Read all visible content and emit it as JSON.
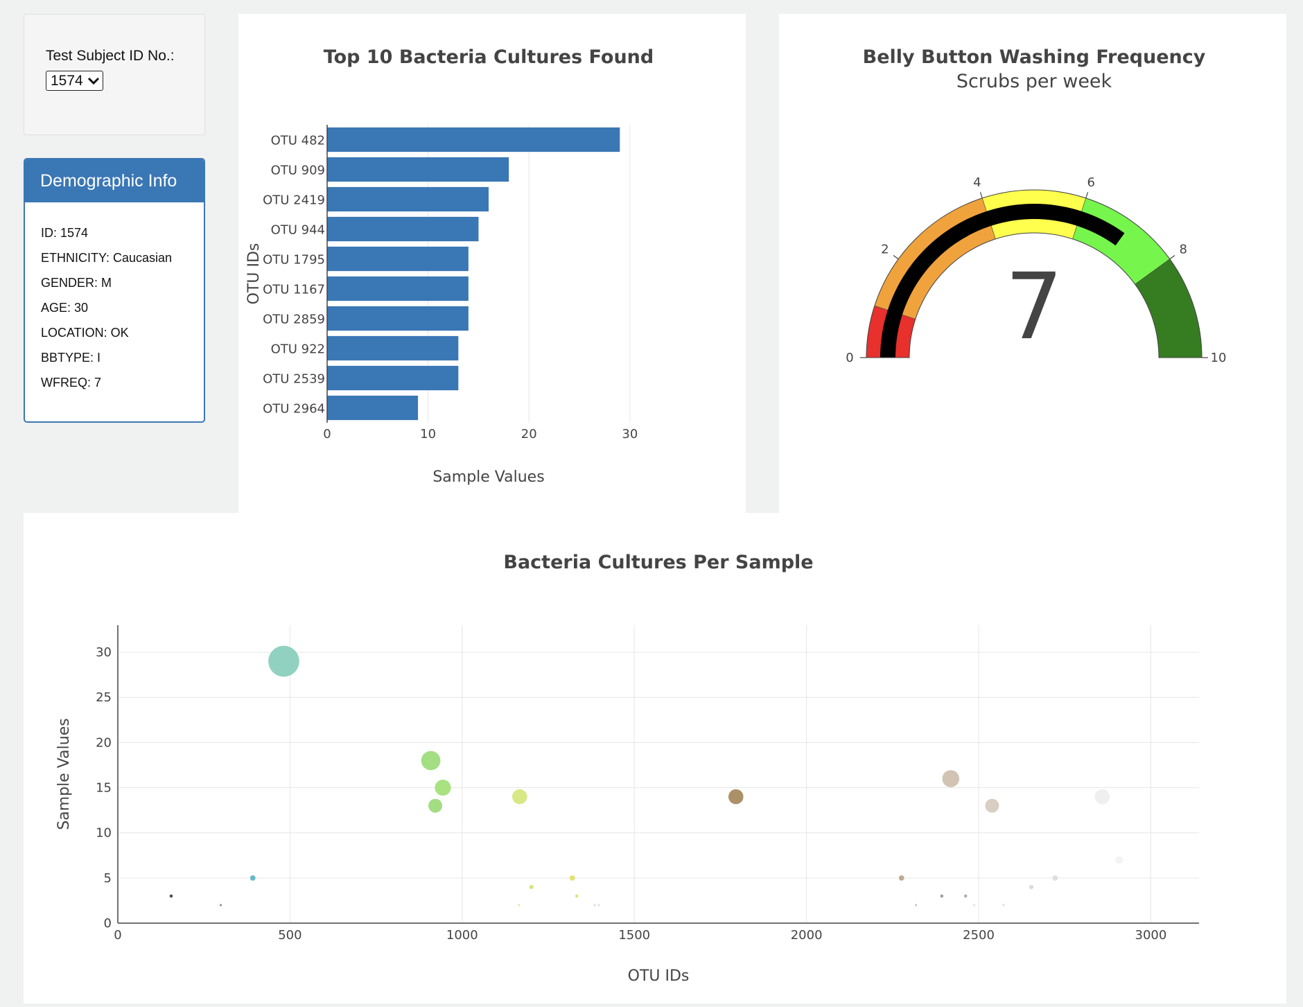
{
  "selector": {
    "label": "Test Subject ID No.:",
    "value": "1574"
  },
  "demographics": {
    "title": "Demographic Info",
    "rows": [
      "ID: 1574",
      "ETHNICITY: Caucasian",
      "GENDER: M",
      "AGE: 30",
      "LOCATION: OK",
      "BBTYPE: I",
      "WFREQ: 7"
    ]
  },
  "colors": {
    "accent": "#3a77b5",
    "bar": "#3a77b5"
  },
  "chart_data": [
    {
      "type": "bar",
      "orientation": "horizontal",
      "title": "Top 10 Bacteria Cultures Found",
      "xlabel": "Sample Values",
      "ylabel": "OTU IDs",
      "categories": [
        "OTU 482",
        "OTU 909",
        "OTU 2419",
        "OTU 944",
        "OTU 1795",
        "OTU 1167",
        "OTU 2859",
        "OTU 922",
        "OTU 2539",
        "OTU 2964"
      ],
      "values": [
        29,
        18,
        16,
        15,
        14,
        14,
        14,
        13,
        13,
        9
      ],
      "xlim": [
        0,
        32
      ],
      "xticks": [
        0,
        10,
        20,
        30
      ],
      "grid": true
    },
    {
      "type": "gauge",
      "title": "Belly Button Washing Frequency",
      "subtitle": "Scrubs per week",
      "value": 7,
      "range": [
        0,
        10
      ],
      "ticks": [
        0,
        2,
        4,
        6,
        8,
        10
      ],
      "steps": [
        {
          "range": [
            0,
            1
          ],
          "color": "#e8302c"
        },
        {
          "range": [
            1,
            4
          ],
          "color": "#f0a33c"
        },
        {
          "range": [
            4,
            6
          ],
          "color": "#ffff4d"
        },
        {
          "range": [
            6,
            8
          ],
          "color": "#76f54c"
        },
        {
          "range": [
            8,
            10
          ],
          "color": "#367d22"
        }
      ],
      "bar_color": "#000000"
    },
    {
      "type": "scatter",
      "subtype": "bubble",
      "title": "Bacteria Cultures Per Sample",
      "xlabel": "OTU IDs",
      "ylabel": "Sample Values",
      "xlim": [
        0,
        3140
      ],
      "ylim": [
        0,
        33
      ],
      "xticks": [
        0,
        500,
        1000,
        1500,
        2000,
        2500,
        3000
      ],
      "yticks": [
        0,
        5,
        10,
        15,
        20,
        25,
        30
      ],
      "grid": true,
      "points": [
        {
          "x": 482,
          "y": 29,
          "color": "#8bcfbd"
        },
        {
          "x": 909,
          "y": 18,
          "color": "#9edc7c"
        },
        {
          "x": 944,
          "y": 15,
          "color": "#a3e07a"
        },
        {
          "x": 922,
          "y": 13,
          "color": "#9ddb7a"
        },
        {
          "x": 1167,
          "y": 14,
          "color": "#d6e77e"
        },
        {
          "x": 1795,
          "y": 14,
          "color": "#a88a60"
        },
        {
          "x": 2419,
          "y": 16,
          "color": "#cfc1b0"
        },
        {
          "x": 2539,
          "y": 13,
          "color": "#d6cbbe"
        },
        {
          "x": 2859,
          "y": 14,
          "color": "#eeeeee"
        },
        {
          "x": 392,
          "y": 5,
          "color": "#5fb5c4"
        },
        {
          "x": 1320,
          "y": 5,
          "color": "#e0e06a"
        },
        {
          "x": 2276,
          "y": 5,
          "color": "#b8a88e"
        },
        {
          "x": 2722,
          "y": 5,
          "color": "#dcdcdc"
        },
        {
          "x": 155,
          "y": 3,
          "color": "#444444"
        },
        {
          "x": 1201,
          "y": 4,
          "color": "#d9e07a"
        },
        {
          "x": 2653,
          "y": 4,
          "color": "#d8d8d8"
        },
        {
          "x": 2908,
          "y": 7,
          "color": "#f2f2f2"
        },
        {
          "x": 1333,
          "y": 3,
          "color": "#e0e070"
        },
        {
          "x": 2393,
          "y": 3,
          "color": "#999999"
        },
        {
          "x": 2462,
          "y": 3,
          "color": "#aaaaaa"
        },
        {
          "x": 299,
          "y": 2,
          "color": "#888888"
        },
        {
          "x": 2318,
          "y": 2,
          "color": "#c8c0b0"
        },
        {
          "x": 1165,
          "y": 2,
          "color": "#dde6a0"
        },
        {
          "x": 1385,
          "y": 2,
          "color": "#d9d9d9"
        },
        {
          "x": 1397,
          "y": 2,
          "color": "#dddddd"
        },
        {
          "x": 2572,
          "y": 2,
          "color": "#dddddd"
        },
        {
          "x": 2487,
          "y": 2,
          "color": "#e0e0e0"
        }
      ]
    }
  ]
}
